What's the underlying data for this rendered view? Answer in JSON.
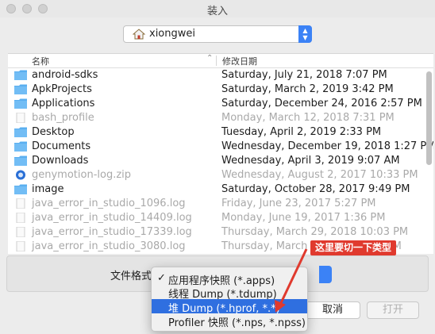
{
  "window": {
    "title": "装入"
  },
  "location": {
    "label": "xiongwei",
    "icon": "home-icon"
  },
  "columns": {
    "name": "名称",
    "date": "修改日期"
  },
  "files": [
    {
      "name": "android-sdks",
      "date": "Saturday, July 21, 2018 7:07 PM",
      "icon": "folder-icon",
      "dim": false
    },
    {
      "name": "ApkProjects",
      "date": "Saturday, March 2, 2019 3:42 PM",
      "icon": "folder-icon",
      "dim": false
    },
    {
      "name": "Applications",
      "date": "Saturday, December 24, 2016 2:57 PM",
      "icon": "folder-icon",
      "dim": false
    },
    {
      "name": "bash_profile",
      "date": "Monday, March 12, 2018 7:31 PM",
      "icon": "file-icon",
      "dim": true
    },
    {
      "name": "Desktop",
      "date": "Tuesday, April 2, 2019 2:33 PM",
      "icon": "folder-icon",
      "dim": false
    },
    {
      "name": "Documents",
      "date": "Wednesday, December 19, 2018 1:27 PM",
      "icon": "folder-icon",
      "dim": false
    },
    {
      "name": "Downloads",
      "date": "Wednesday, April 3, 2019 9:07 AM",
      "icon": "folder-icon",
      "dim": false
    },
    {
      "name": "genymotion-log.zip",
      "date": "Wednesday, August 2, 2017 10:33 PM",
      "icon": "zip-icon",
      "dim": true
    },
    {
      "name": "image",
      "date": "Saturday, October 28, 2017 9:49 PM",
      "icon": "folder-icon",
      "dim": false
    },
    {
      "name": "java_error_in_studio_1096.log",
      "date": "Friday, June 23, 2017 5:27 PM",
      "icon": "file-icon",
      "dim": true
    },
    {
      "name": "java_error_in_studio_14409.log",
      "date": "Monday, June 19, 2017 1:36 PM",
      "icon": "file-icon",
      "dim": true
    },
    {
      "name": "java_error_in_studio_17339.log",
      "date": "Thursday, March 29, 2018 10:03 PM",
      "icon": "file-icon",
      "dim": true
    },
    {
      "name": "java_error_in_studio_3080.log",
      "date": "Thursday, March 15, 2018 2:00 PM",
      "icon": "file-icon",
      "dim": true
    }
  ],
  "format": {
    "label": "文件格式:"
  },
  "menu": {
    "items": [
      {
        "label": "应用程序快照 (*.apps)",
        "checked": true,
        "selected": false
      },
      {
        "label": "线程 Dump (*.tdump)",
        "checked": false,
        "selected": false
      },
      {
        "label": "堆 Dump (*.hprof, *.*)",
        "checked": false,
        "selected": true
      },
      {
        "label": "Profiler 快照 (*.nps, *.npss)",
        "checked": false,
        "selected": false
      }
    ],
    "check_mark": "✓"
  },
  "buttons": {
    "cancel": "取消",
    "open": "打开"
  },
  "annotation": {
    "text": "这里要切一下类型",
    "color": "#e03a2e"
  },
  "colors": {
    "accent": "#3b82f6",
    "folder": "#5aaff0",
    "selection": "#2f6fe0"
  }
}
